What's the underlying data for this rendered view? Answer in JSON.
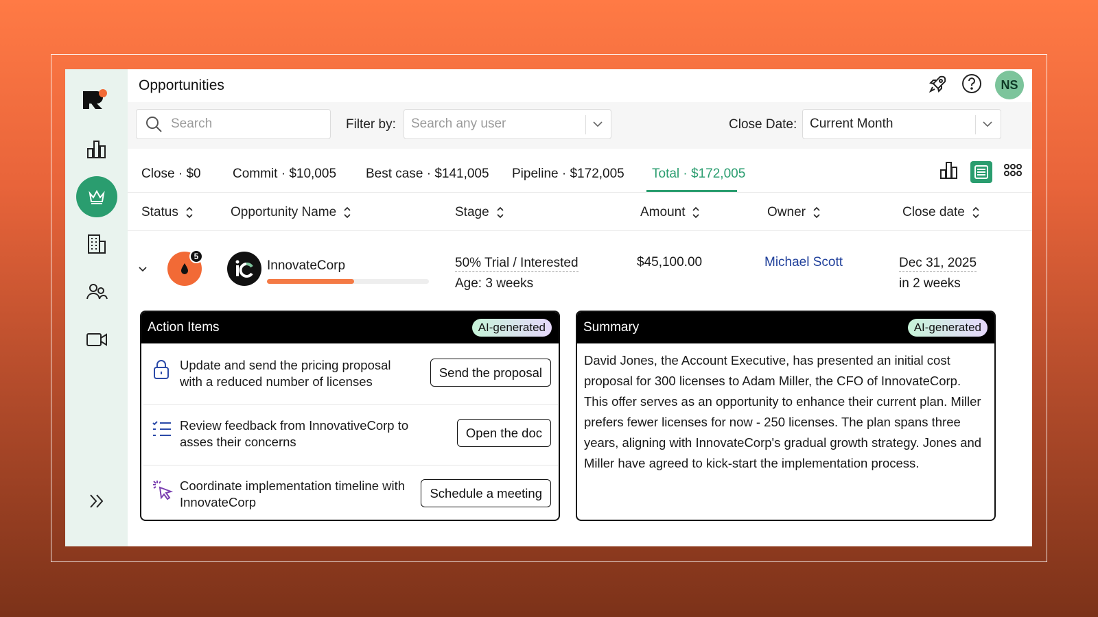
{
  "page": {
    "title": "Opportunities"
  },
  "user": {
    "initials": "NS"
  },
  "filters": {
    "search_placeholder": "Search",
    "filter_by_label": "Filter by:",
    "user_placeholder": "Search any user",
    "close_date_label": "Close Date:",
    "close_date_value": "Current Month"
  },
  "tabs": [
    {
      "label": "Close · $0"
    },
    {
      "label": "Commit · $10,005"
    },
    {
      "label": "Best case · $141,005"
    },
    {
      "label": "Pipeline · $172,005"
    },
    {
      "label": "Total · $172,005"
    }
  ],
  "columns": [
    {
      "label": "Status"
    },
    {
      "label": "Opportunity Name"
    },
    {
      "label": "Stage"
    },
    {
      "label": "Amount"
    },
    {
      "label": "Owner"
    },
    {
      "label": "Close date"
    }
  ],
  "row": {
    "status_count": "5",
    "company": "InnovateCorp",
    "progress": 0.54,
    "stage": "50% Trial / Interested",
    "age": "Age: 3 weeks",
    "amount": "$45,100.00",
    "owner": "Michael Scott",
    "close_date": "Dec 31, 2025",
    "close_relative": "in 2 weeks"
  },
  "action_items": {
    "title": "Action Items",
    "ai_label": "AI-generated",
    "items": [
      {
        "icon": "lock-icon",
        "text": "Update and send the pricing proposal with a reduced number of licenses",
        "button": "Send the proposal"
      },
      {
        "icon": "list-icon",
        "text": "Review feedback from InnovativeCorp to asses their concerns",
        "button": "Open the doc"
      },
      {
        "icon": "cursor-click-icon",
        "text": "Coordinate implementation timeline with InnovateCorp",
        "button": "Schedule a meeting"
      }
    ]
  },
  "summary": {
    "title": "Summary",
    "ai_label": "AI-generated",
    "text": "David Jones, the Account Executive, has presented an initial cost proposal for 300 licenses to Adam Miller, the CFO of InnovateCorp. This offer serves as an opportunity to enhance their current plan. Miller prefers fewer licenses for now - 250 licenses. The plan spans three years, aligning with InnovateCorp's gradual growth strategy. Jones and Miller have agreed to kick-start the implementation process."
  },
  "colors": {
    "accent": "#2a9d6f",
    "status": "#f26a36",
    "owner_link": "#1f3f9a",
    "sidebar_bg": "#e9f3ee"
  }
}
